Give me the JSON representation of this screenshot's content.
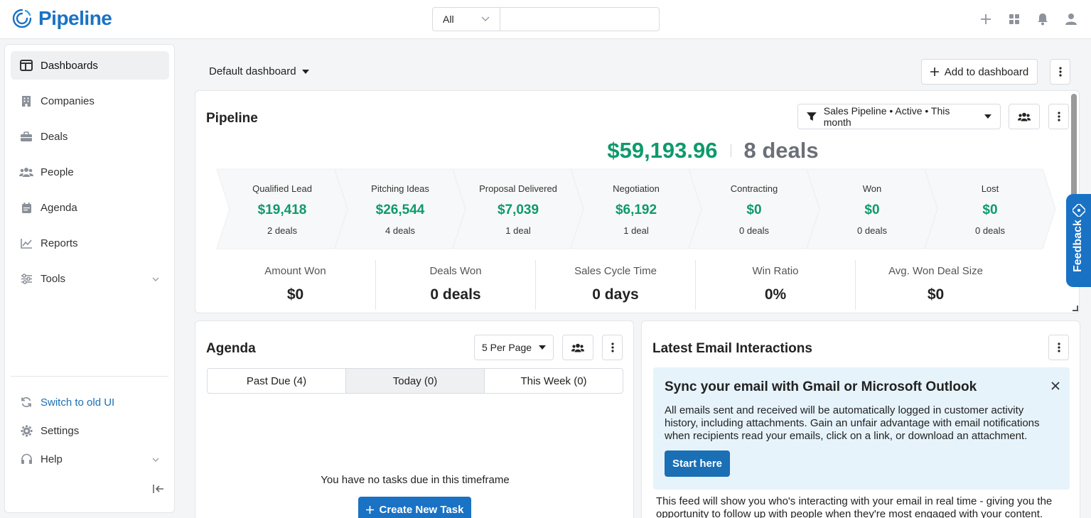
{
  "app": {
    "name": "Pipeline"
  },
  "search": {
    "scope": "All",
    "placeholder": ""
  },
  "topbar_icons": [
    "plus-icon",
    "apps-grid-icon",
    "bell-icon",
    "user-icon"
  ],
  "sidebar": {
    "items": [
      {
        "label": "Dashboards",
        "icon": "dashboard-icon"
      },
      {
        "label": "Companies",
        "icon": "building-icon"
      },
      {
        "label": "Deals",
        "icon": "briefcase-icon"
      },
      {
        "label": "People",
        "icon": "people-icon"
      },
      {
        "label": "Agenda",
        "icon": "calendar-icon"
      },
      {
        "label": "Reports",
        "icon": "chart-line-icon"
      },
      {
        "label": "Tools",
        "icon": "sliders-icon"
      }
    ],
    "bottom": [
      {
        "label": "Switch to old UI",
        "icon": "refresh-icon"
      },
      {
        "label": "Settings",
        "icon": "gear-icon"
      },
      {
        "label": "Help",
        "icon": "headset-icon"
      }
    ]
  },
  "header": {
    "dashboard_select": "Default dashboard",
    "add_label": "Add to dashboard"
  },
  "pipeline": {
    "title": "Pipeline",
    "filter": "Sales Pipeline • Active • This month",
    "total_amount": "$59,193.96",
    "total_deals": "8 deals",
    "stages": [
      {
        "name": "Qualified Lead",
        "amount": "$19,418",
        "deals": "2 deals"
      },
      {
        "name": "Pitching Ideas",
        "amount": "$26,544",
        "deals": "4 deals"
      },
      {
        "name": "Proposal Delivered",
        "amount": "$7,039",
        "deals": "1 deal"
      },
      {
        "name": "Negotiation",
        "amount": "$6,192",
        "deals": "1 deal"
      },
      {
        "name": "Contracting",
        "amount": "$0",
        "deals": "0 deals"
      },
      {
        "name": "Won",
        "amount": "$0",
        "deals": "0 deals"
      },
      {
        "name": "Lost",
        "amount": "$0",
        "deals": "0 deals"
      }
    ],
    "metrics": [
      {
        "label": "Amount Won",
        "value": "$0"
      },
      {
        "label": "Deals Won",
        "value": "0 deals"
      },
      {
        "label": "Sales Cycle Time",
        "value": "0 days"
      },
      {
        "label": "Win Ratio",
        "value": "0%"
      },
      {
        "label": "Avg. Won Deal Size",
        "value": "$0"
      }
    ]
  },
  "agenda": {
    "title": "Agenda",
    "per_page": "5 Per Page",
    "tabs": [
      "Past Due (4)",
      "Today (0)",
      "This Week (0)"
    ],
    "empty_message": "You have no tasks due in this timeframe",
    "create_label": "Create New Task"
  },
  "email": {
    "title": "Latest Email Interactions",
    "sync_title": "Sync your email with Gmail or Microsoft Outlook",
    "sync_body": "All emails sent and received will be automatically logged in customer activity history, including attachments. Gain an unfair advantage with email notifications when recipients read your emails, click on a link, or download an attachment.",
    "start_label": "Start here",
    "feed_text": "This feed will show you who's interacting with your email in real time - giving you the opportunity to follow up with people when they're most engaged with your content."
  },
  "feedback": {
    "label": "Feedback"
  },
  "colors": {
    "brand": "#1a72c4",
    "money": "#0e9a6a"
  }
}
